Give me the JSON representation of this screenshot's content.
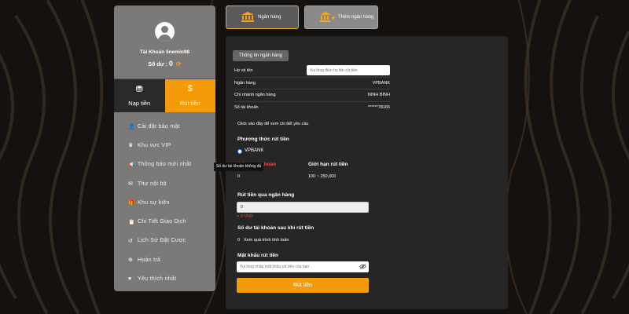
{
  "colors": {
    "accent": "#f59b0a",
    "panel_dark": "#262626",
    "sidebar": "#7b7a78",
    "error": "#d9534f"
  },
  "sidebar": {
    "account_name": "Tài Khoản linemin98",
    "balance_label": "Số dư :",
    "balance_value": "0",
    "refresh_icon": "refresh-icon",
    "tabs": [
      {
        "label": "Nạp tiền",
        "icon": "deposit-icon"
      },
      {
        "label": "Rút tiền",
        "icon": "withdraw-icon"
      }
    ],
    "menu": [
      {
        "label": "Cài đặt bảo mật",
        "icon": "user-gear-icon"
      },
      {
        "label": "Khu vực VIP",
        "icon": "crown-icon"
      },
      {
        "label": "Thông báo mới nhất",
        "icon": "megaphone-icon"
      },
      {
        "label": "Thư nội bộ",
        "icon": "mail-icon"
      },
      {
        "label": "Khu sự kiện",
        "icon": "gift-icon"
      },
      {
        "label": "Chi Tiết Giao Dịch",
        "icon": "clipboard-icon"
      },
      {
        "label": "Lịch Sử Đặt Cược",
        "icon": "history-icon"
      },
      {
        "label": "Hoàn trả",
        "icon": "refund-icon"
      },
      {
        "label": "Yêu thích nhất",
        "icon": "heart-icon"
      }
    ]
  },
  "top_buttons": {
    "bank": "Ngân hàng",
    "add_bank": "Thêm ngân hàng"
  },
  "bank_info": {
    "section_title": "Thông tin ngân hàng",
    "name_label": "Họ và tên",
    "name_placeholder": "Vui lòng điền họ tên rút tiền",
    "bank_label": "Ngân hàng",
    "bank_value": "VPBANK",
    "branch_label": "Chi nhánh ngân hàng",
    "branch_value": "NINH BÌNH",
    "account_label": "Số tài khoản",
    "account_value": "******78165",
    "click_hint": "Click vào đây để xem chi tiết yêu cầu"
  },
  "withdraw": {
    "method_title": "Phương thức rút tiền",
    "method_option": "VPBANK",
    "account_balance_label": "Số dư tài khoản",
    "account_balance_value": "0",
    "limit_label": "Giới hạn rút tiền",
    "limit_value": "100 ~ 250,000",
    "bank_withdraw_label": "Rút tiền qua ngân hàng",
    "amount_value": "0",
    "amount_note": "= 0 VND",
    "after_balance_label": "Số dư tài khoản sau khi rút tiền",
    "after_balance_value": "0",
    "calc_hint": "Xem quá trình tính toán",
    "password_label": "Mật khẩu rút tiền",
    "password_placeholder": "Vui lòng nhập mật khẩu rút tiền của bạn",
    "submit_label": "Rút tiền"
  },
  "tooltip": "Số dư tài khoản không đủ"
}
